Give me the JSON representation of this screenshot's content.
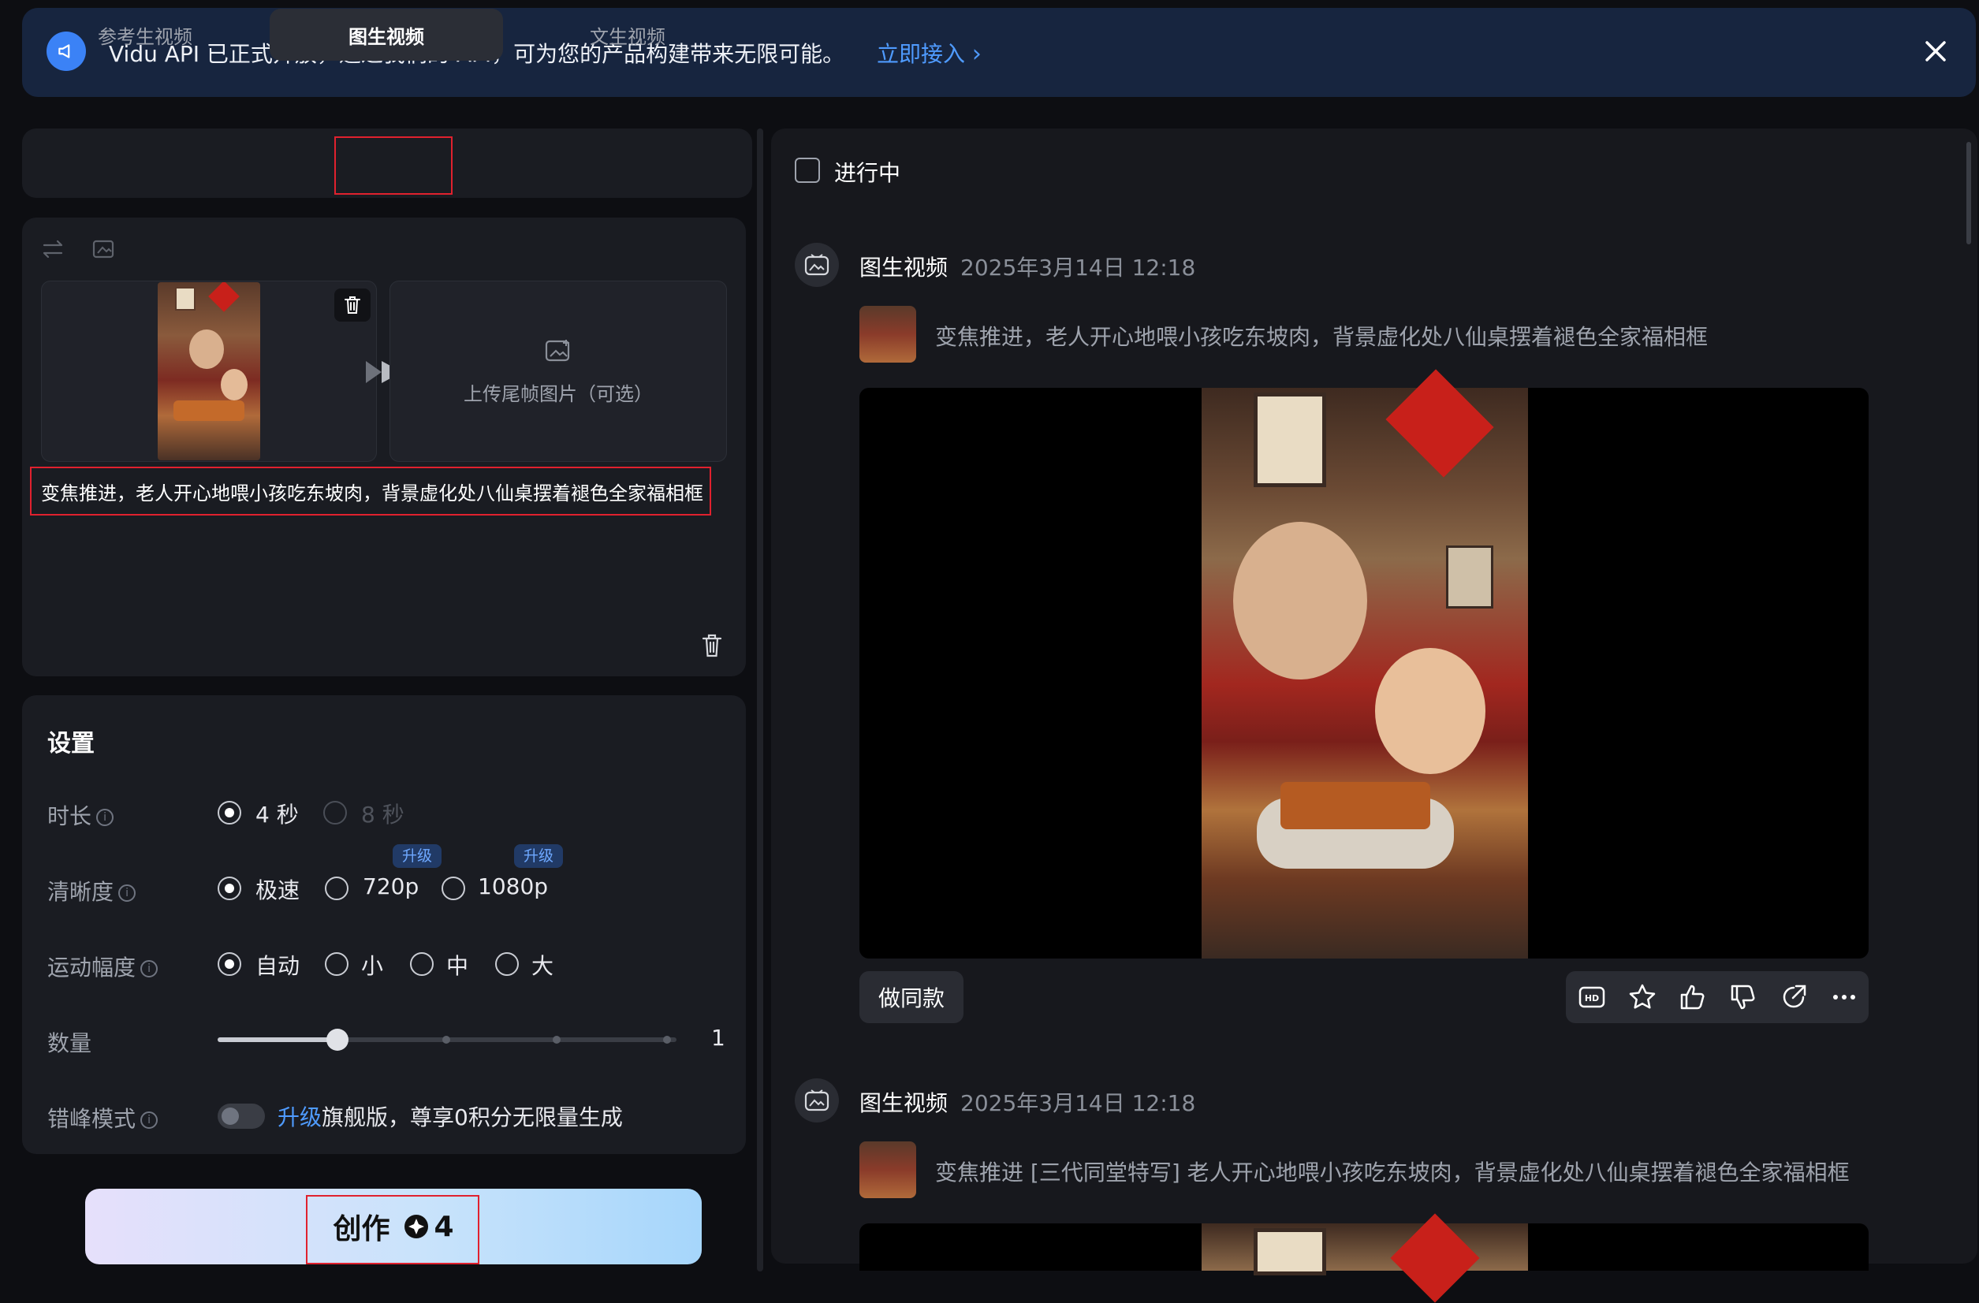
{
  "banner": {
    "text": "Vidu API 已正式开放，通过我们的 API，可为您的产品构建带来无限可能。",
    "link": "立即接入"
  },
  "tabs": [
    "参考生视频",
    "图生视频",
    "文生视频"
  ],
  "upload": {
    "end_frame": "上传尾帧图片（可选）"
  },
  "prompt": "变焦推进，老人开心地喂小孩吃东坡肉，背景虚化处八仙桌摆着褪色全家福相框",
  "settings": {
    "title": "设置",
    "duration": {
      "label": "时长",
      "options": [
        "4 秒",
        "8 秒"
      ]
    },
    "resolution": {
      "label": "清晰度",
      "options": [
        "极速",
        "720p",
        "1080p"
      ],
      "badge": "升级"
    },
    "motion": {
      "label": "运动幅度",
      "options": [
        "自动",
        "小",
        "中",
        "大"
      ]
    },
    "quantity": {
      "label": "数量",
      "value": "1"
    },
    "offpeak": {
      "label": "错峰模式",
      "upgrade": "升级",
      "text": "旗舰版，尊享0积分无限量生成"
    }
  },
  "create": {
    "label": "创作",
    "cost": "4"
  },
  "right": {
    "filter_label": "进行中",
    "items": [
      {
        "type": "图生视频",
        "date": "2025年3月14日 12:18",
        "prompt": "变焦推进，老人开心地喂小孩吃东坡肉，背景虚化处八仙桌摆着褪色全家福相框"
      },
      {
        "type": "图生视频",
        "date": "2025年3月14日 12:18",
        "prompt": "变焦推进 [三代同堂特写] 老人开心地喂小孩吃东坡肉，背景虚化处八仙桌摆着褪色全家福相框"
      }
    ],
    "same_button": "做同款",
    "hd_label": "HD"
  },
  "colors": {
    "accent": "#4f9bff",
    "highlight_box": "#e0212e",
    "panel": "#1a1c22"
  }
}
